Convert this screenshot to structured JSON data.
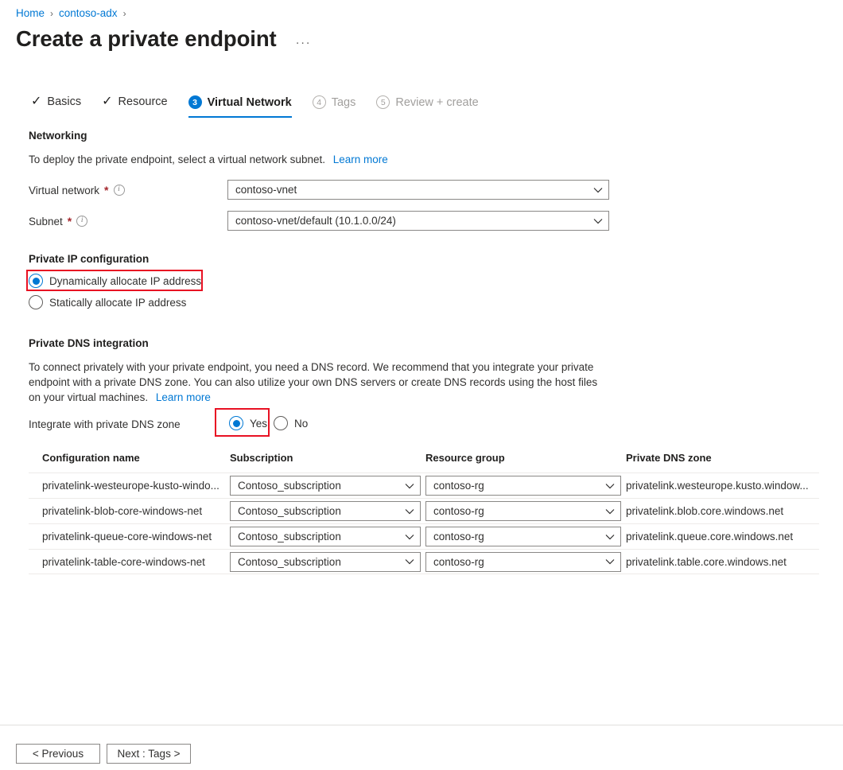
{
  "breadcrumb": {
    "items": [
      {
        "label": "Home"
      },
      {
        "label": "contoso-adx"
      }
    ],
    "separator": "›"
  },
  "header": {
    "title": "Create a private endpoint",
    "more_menu": "···"
  },
  "tabs": [
    {
      "label": "Basics",
      "state": "done",
      "marker": "✓"
    },
    {
      "label": "Resource",
      "state": "done",
      "marker": "✓"
    },
    {
      "label": "Virtual Network",
      "state": "active",
      "marker": "3"
    },
    {
      "label": "Tags",
      "state": "disabled",
      "marker": "4"
    },
    {
      "label": "Review + create",
      "state": "disabled",
      "marker": "5"
    }
  ],
  "networking": {
    "heading": "Networking",
    "description": "To deploy the private endpoint, select a virtual network subnet.",
    "learn_more": "Learn more",
    "virtual_network": {
      "label": "Virtual network",
      "required_marker": "*",
      "value": "contoso-vnet"
    },
    "subnet": {
      "label": "Subnet",
      "required_marker": "*",
      "value": "contoso-vnet/default (10.1.0.0/24)"
    }
  },
  "private_ip": {
    "heading": "Private IP configuration",
    "options": [
      {
        "label": "Dynamically allocate IP address",
        "selected": true
      },
      {
        "label": "Statically allocate IP address",
        "selected": false
      }
    ]
  },
  "private_dns": {
    "heading": "Private DNS integration",
    "description": "To connect privately with your private endpoint, you need a DNS record. We recommend that you integrate your private endpoint with a private DNS zone. You can also utilize your own DNS servers or create DNS records using the host files on your virtual machines.",
    "learn_more": "Learn more",
    "integrate_label": "Integrate with private DNS zone",
    "options": [
      {
        "label": "Yes",
        "selected": true
      },
      {
        "label": "No",
        "selected": false
      }
    ]
  },
  "table": {
    "columns": [
      "Configuration name",
      "Subscription",
      "Resource group",
      "Private DNS zone"
    ],
    "rows": [
      {
        "configuration_name": "privatelink-westeurope-kusto-windo...",
        "subscription": "Contoso_subscription",
        "resource_group": "contoso-rg",
        "private_dns_zone": "privatelink.westeurope.kusto.window..."
      },
      {
        "configuration_name": "privatelink-blob-core-windows-net",
        "subscription": "Contoso_subscription",
        "resource_group": "contoso-rg",
        "private_dns_zone": "privatelink.blob.core.windows.net"
      },
      {
        "configuration_name": "privatelink-queue-core-windows-net",
        "subscription": "Contoso_subscription",
        "resource_group": "contoso-rg",
        "private_dns_zone": "privatelink.queue.core.windows.net"
      },
      {
        "configuration_name": "privatelink-table-core-windows-net",
        "subscription": "Contoso_subscription",
        "resource_group": "contoso-rg",
        "private_dns_zone": "privatelink.table.core.windows.net"
      }
    ]
  },
  "footer": {
    "previous_label": "< Previous",
    "next_label": "Next : Tags >"
  },
  "colors": {
    "accent": "#0078d4",
    "highlight": "#e81123",
    "required": "#a4262c",
    "disabled_text": "#a19f9d"
  }
}
